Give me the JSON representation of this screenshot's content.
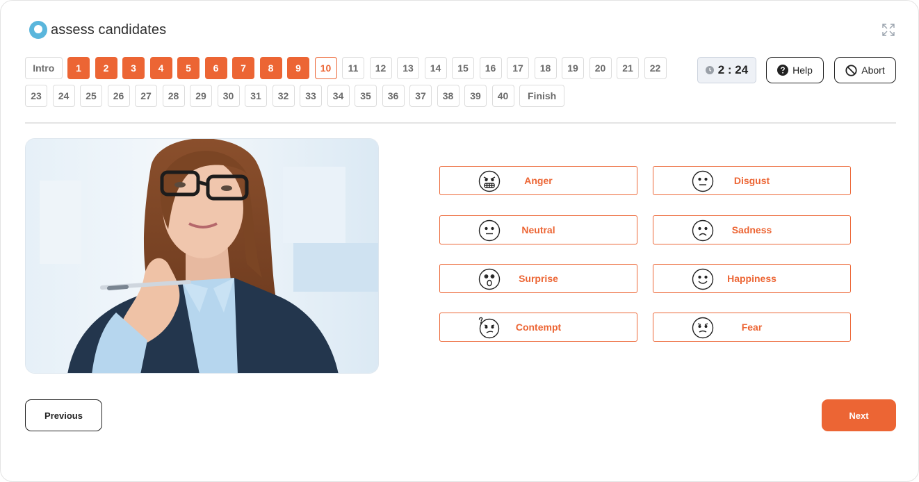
{
  "brand": {
    "name": "assess candidates",
    "accent": "#ec6534",
    "logo_color": "#5ab6dc"
  },
  "question_nav": {
    "row1": [
      {
        "label": "Intro",
        "state": "default"
      },
      {
        "label": "1",
        "state": "answered"
      },
      {
        "label": "2",
        "state": "answered"
      },
      {
        "label": "3",
        "state": "answered"
      },
      {
        "label": "4",
        "state": "answered"
      },
      {
        "label": "5",
        "state": "answered"
      },
      {
        "label": "6",
        "state": "answered"
      },
      {
        "label": "7",
        "state": "answered"
      },
      {
        "label": "8",
        "state": "answered"
      },
      {
        "label": "9",
        "state": "answered"
      },
      {
        "label": "10",
        "state": "current"
      },
      {
        "label": "11",
        "state": "default"
      },
      {
        "label": "12",
        "state": "default"
      },
      {
        "label": "13",
        "state": "default"
      },
      {
        "label": "14",
        "state": "default"
      },
      {
        "label": "15",
        "state": "default"
      },
      {
        "label": "16",
        "state": "default"
      },
      {
        "label": "17",
        "state": "default"
      },
      {
        "label": "18",
        "state": "default"
      },
      {
        "label": "19",
        "state": "default"
      },
      {
        "label": "20",
        "state": "default"
      },
      {
        "label": "21",
        "state": "default"
      },
      {
        "label": "22",
        "state": "default"
      }
    ],
    "row2": [
      {
        "label": "23",
        "state": "default"
      },
      {
        "label": "24",
        "state": "default"
      },
      {
        "label": "25",
        "state": "default"
      },
      {
        "label": "26",
        "state": "default"
      },
      {
        "label": "27",
        "state": "default"
      },
      {
        "label": "28",
        "state": "default"
      },
      {
        "label": "29",
        "state": "default"
      },
      {
        "label": "30",
        "state": "default"
      },
      {
        "label": "31",
        "state": "default"
      },
      {
        "label": "32",
        "state": "default"
      },
      {
        "label": "33",
        "state": "default"
      },
      {
        "label": "34",
        "state": "default"
      },
      {
        "label": "35",
        "state": "default"
      },
      {
        "label": "36",
        "state": "default"
      },
      {
        "label": "37",
        "state": "default"
      },
      {
        "label": "38",
        "state": "default"
      },
      {
        "label": "39",
        "state": "default"
      },
      {
        "label": "40",
        "state": "default"
      },
      {
        "label": "Finish",
        "state": "default"
      }
    ]
  },
  "header": {
    "timer": "2 : 24",
    "help_label": "Help",
    "abort_label": "Abort"
  },
  "options": [
    {
      "label": "Anger",
      "icon": "anger-face-icon"
    },
    {
      "label": "Disgust",
      "icon": "disgust-face-icon"
    },
    {
      "label": "Neutral",
      "icon": "neutral-face-icon"
    },
    {
      "label": "Sadness",
      "icon": "sadness-face-icon"
    },
    {
      "label": "Surprise",
      "icon": "surprise-face-icon"
    },
    {
      "label": "Happiness",
      "icon": "happiness-face-icon"
    },
    {
      "label": "Contempt",
      "icon": "contempt-face-icon"
    },
    {
      "label": "Fear",
      "icon": "fear-face-icon"
    }
  ],
  "footer": {
    "previous_label": "Previous",
    "next_label": "Next"
  }
}
